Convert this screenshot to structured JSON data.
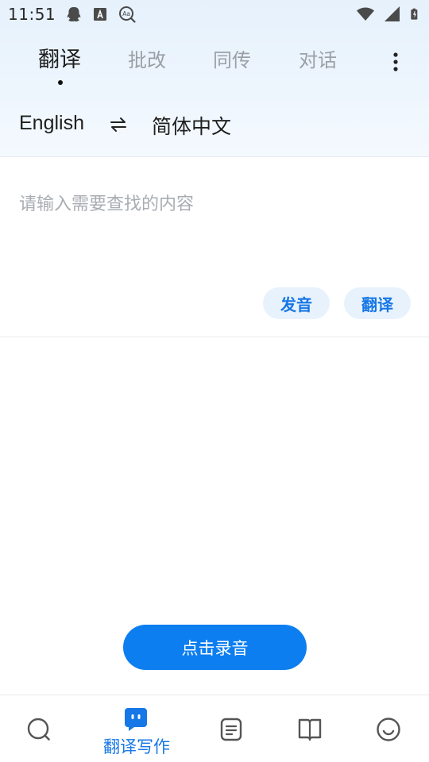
{
  "status_bar": {
    "time": "11:51",
    "left_icons": [
      "qq-icon",
      "font-a-icon",
      "aa-search-icon"
    ],
    "right_icons": [
      "wifi-icon",
      "signal-icon",
      "battery-icon"
    ]
  },
  "tabs": [
    {
      "label": "翻译",
      "active": true
    },
    {
      "label": "批改",
      "active": false
    },
    {
      "label": "同传",
      "active": false
    },
    {
      "label": "对话",
      "active": false
    }
  ],
  "menu_icon": "more-vertical-icon",
  "languages": {
    "source": "English",
    "swap_icon": "swap-arrows-icon",
    "target": "简体中文"
  },
  "input": {
    "placeholder": "请输入需要查找的内容",
    "value": ""
  },
  "actions": {
    "speak_label": "发音",
    "translate_label": "翻译"
  },
  "record_button": "点击录音",
  "bottom_nav": [
    {
      "icon": "search-icon",
      "label": "",
      "active": false
    },
    {
      "icon": "chat-bubble-icon",
      "label": "翻译写作",
      "active": true
    },
    {
      "icon": "notes-icon",
      "label": "",
      "active": false
    },
    {
      "icon": "book-icon",
      "label": "",
      "active": false
    },
    {
      "icon": "smiley-icon",
      "label": "",
      "active": false
    }
  ],
  "colors": {
    "accent": "#0d7ef0",
    "accent_text": "#1677e6",
    "pill_bg": "#e8f2fd",
    "header_bg": "#e6f1fc"
  }
}
